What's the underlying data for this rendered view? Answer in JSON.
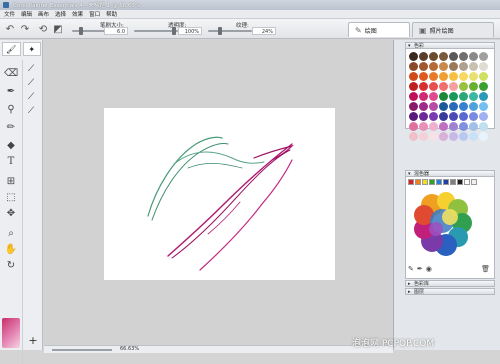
{
  "app": {
    "title": "Corel Painter Essentials 4 - 未标题-1 @ 66.63%"
  },
  "menu": [
    "文件",
    "编辑",
    "画布",
    "选择",
    "效果",
    "窗口",
    "帮助"
  ],
  "toolbar": {
    "brush_size_label": "笔刷大小:",
    "brush_size_value": "6.0",
    "opacity_label": "透明度:",
    "opacity_value": "100%",
    "grain_label": "纹理:",
    "grain_value": "24%"
  },
  "tabs": [
    {
      "label": "绘图",
      "active": true
    },
    {
      "label": "照片绘图",
      "active": false
    }
  ],
  "status": {
    "zoom": "66.63%"
  },
  "panels": {
    "colors_title": "色彩",
    "mixer_title": "混色器",
    "color_set_title": "色彩库",
    "layers_title": "图层"
  },
  "colors": {
    "swatches": [
      "#3b2a20",
      "#5a3e2b",
      "#6b4a2e",
      "#7a5a3a",
      "#5a5a5a",
      "#707070",
      "#8a8a8a",
      "#a0a0a0",
      "#8a4a2a",
      "#a0582e",
      "#b86a36",
      "#c88a4a",
      "#9a7a58",
      "#b0a090",
      "#c8c0b0",
      "#e0dcd4",
      "#d04a1a",
      "#e05a20",
      "#e87a2a",
      "#f0a030",
      "#f6c040",
      "#f8d860",
      "#e8e070",
      "#d0e060",
      "#c02020",
      "#d83030",
      "#e85050",
      "#f07070",
      "#f4a0a0",
      "#9ac040",
      "#6ab030",
      "#3aa030",
      "#c0105a",
      "#d02a70",
      "#e04a90",
      "#1a8a3a",
      "#1a9a5a",
      "#2aa878",
      "#3ab8a0",
      "#2a9ab8",
      "#8a1a6a",
      "#a02a8a",
      "#b84aa8",
      "#1a5a9a",
      "#2a6ab8",
      "#3a80d0",
      "#50a0e0",
      "#70c0f0",
      "#5a1a7a",
      "#6a2a9a",
      "#7a3ab0",
      "#3a3a9a",
      "#4a4ab8",
      "#5a6ad0",
      "#7a8ae0",
      "#a0b0f0",
      "#e070a0",
      "#e890b8",
      "#f0b0d0",
      "#c070c0",
      "#a080d0",
      "#8090e0",
      "#a0c0e8",
      "#c0e0f0",
      "#f0c0c8",
      "#f4d0d8",
      "#f8e0e8",
      "#d8b0d8",
      "#c8b8e8",
      "#b8c8f0",
      "#c8e0f8",
      "#e8f4fc"
    ]
  },
  "mixer": {
    "strip_colors": [
      "#e02020",
      "#f08020",
      "#f0e020",
      "#30a030",
      "#2080e0",
      "#2040a0",
      "#808080",
      "#202020",
      "#ffffff",
      "#f0f0f0"
    ],
    "tools": [
      "brush-tool",
      "dropper-tool",
      "sample-tool"
    ]
  }
}
